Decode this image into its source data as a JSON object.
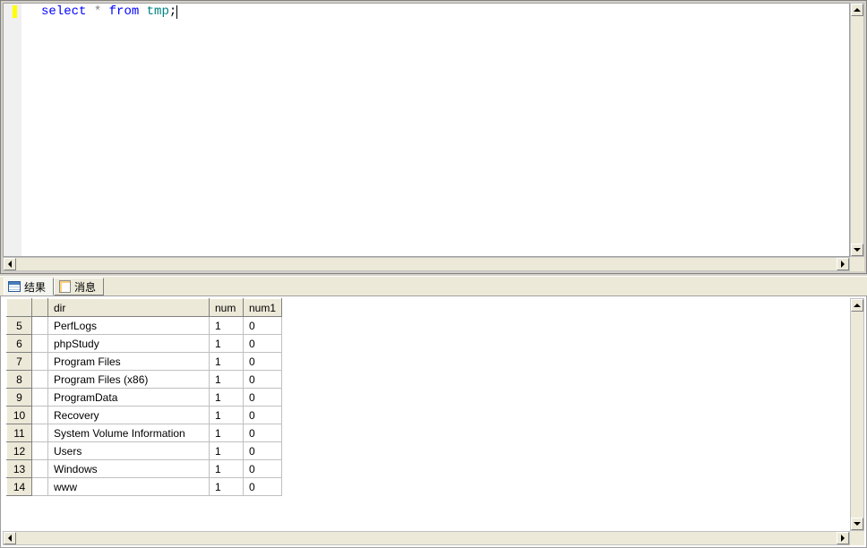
{
  "editor": {
    "sql_select": "select",
    "sql_star": " * ",
    "sql_from": "from",
    "sql_ident": " tmp",
    "sql_semicolon": ";"
  },
  "tabs": {
    "results_label": "结果",
    "messages_label": "消息"
  },
  "grid": {
    "headers": {
      "blank": "",
      "dir": "dir",
      "num": "num",
      "num1": "num1"
    },
    "rows": [
      {
        "n": "5",
        "dir": "PerfLogs",
        "num": "1",
        "num1": "0"
      },
      {
        "n": "6",
        "dir": "phpStudy",
        "num": "1",
        "num1": "0"
      },
      {
        "n": "7",
        "dir": "Program Files",
        "num": "1",
        "num1": "0"
      },
      {
        "n": "8",
        "dir": "Program Files (x86)",
        "num": "1",
        "num1": "0"
      },
      {
        "n": "9",
        "dir": "ProgramData",
        "num": "1",
        "num1": "0"
      },
      {
        "n": "10",
        "dir": "Recovery",
        "num": "1",
        "num1": "0"
      },
      {
        "n": "11",
        "dir": "System Volume Information",
        "num": "1",
        "num1": "0"
      },
      {
        "n": "12",
        "dir": "Users",
        "num": "1",
        "num1": "0"
      },
      {
        "n": "13",
        "dir": "Windows",
        "num": "1",
        "num1": "0"
      },
      {
        "n": "14",
        "dir": "www",
        "num": "1",
        "num1": "0"
      }
    ]
  }
}
